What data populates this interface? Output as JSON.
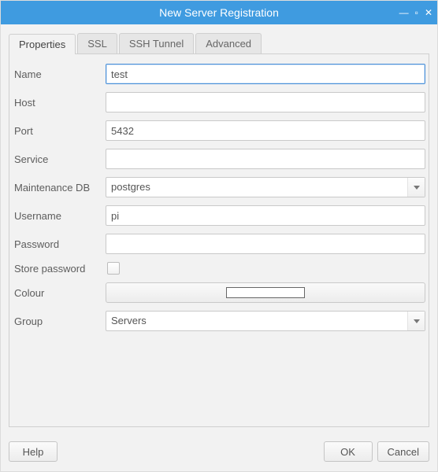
{
  "window": {
    "title": "New Server Registration"
  },
  "tabs": [
    {
      "label": "Properties"
    },
    {
      "label": "SSL"
    },
    {
      "label": "SSH Tunnel"
    },
    {
      "label": "Advanced"
    }
  ],
  "form": {
    "name": {
      "label": "Name",
      "value": "test"
    },
    "host": {
      "label": "Host",
      "value": ""
    },
    "port": {
      "label": "Port",
      "value": "5432"
    },
    "service": {
      "label": "Service",
      "value": ""
    },
    "maintenanceDb": {
      "label": "Maintenance DB",
      "value": "postgres"
    },
    "username": {
      "label": "Username",
      "value": "pi"
    },
    "password": {
      "label": "Password",
      "value": ""
    },
    "storePassword": {
      "label": "Store password",
      "checked": false
    },
    "colour": {
      "label": "Colour",
      "value": "#ffffff"
    },
    "group": {
      "label": "Group",
      "value": "Servers"
    }
  },
  "buttons": {
    "help": "Help",
    "ok": "OK",
    "cancel": "Cancel"
  }
}
